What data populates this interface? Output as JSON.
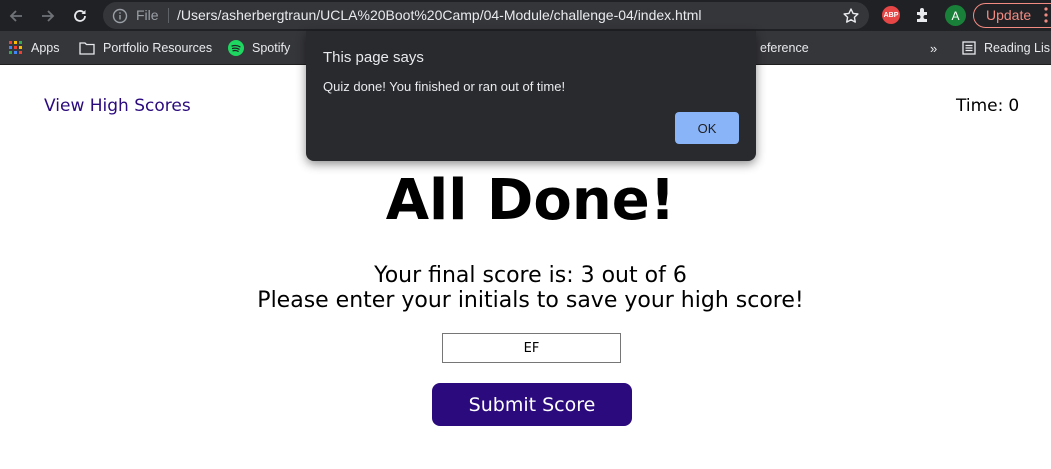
{
  "browser": {
    "omnibox": {
      "scheme_label": "File",
      "url": "/Users/asherbergtraun/UCLA%20Boot%20Camp/04-Module/challenge-04/index.html"
    },
    "extensions": {
      "abp_label": "ABP",
      "avatar_initial": "A"
    },
    "update_label": "Update",
    "bookmarks": [
      {
        "label": "Apps",
        "icon": "apps-grid-icon"
      },
      {
        "label": "Portfolio Resources",
        "icon": "folder-icon"
      },
      {
        "label": "Spotify",
        "icon": "spotify-icon"
      },
      {
        "label": "eference",
        "icon": ""
      },
      {
        "label": "Reading Lis",
        "icon": "reading-list-icon"
      }
    ],
    "more_bookmarks": "»"
  },
  "page": {
    "view_high_scores": "View High Scores",
    "timer_label": "Time:",
    "timer_value": "0",
    "title": "All Done!",
    "score_text": "Your final score is: 3 out of 6",
    "instructions": "Please enter your initials to save your high score!",
    "initials_value": "EF",
    "submit_label": "Submit Score"
  },
  "dialog": {
    "title": "This page says",
    "message": "Quiz done! You finished or ran out of time!",
    "ok_label": "OK"
  },
  "colors": {
    "accent": "#2b0a7d",
    "chrome_bg": "#202124",
    "dialog_button": "#8ab4f8"
  }
}
